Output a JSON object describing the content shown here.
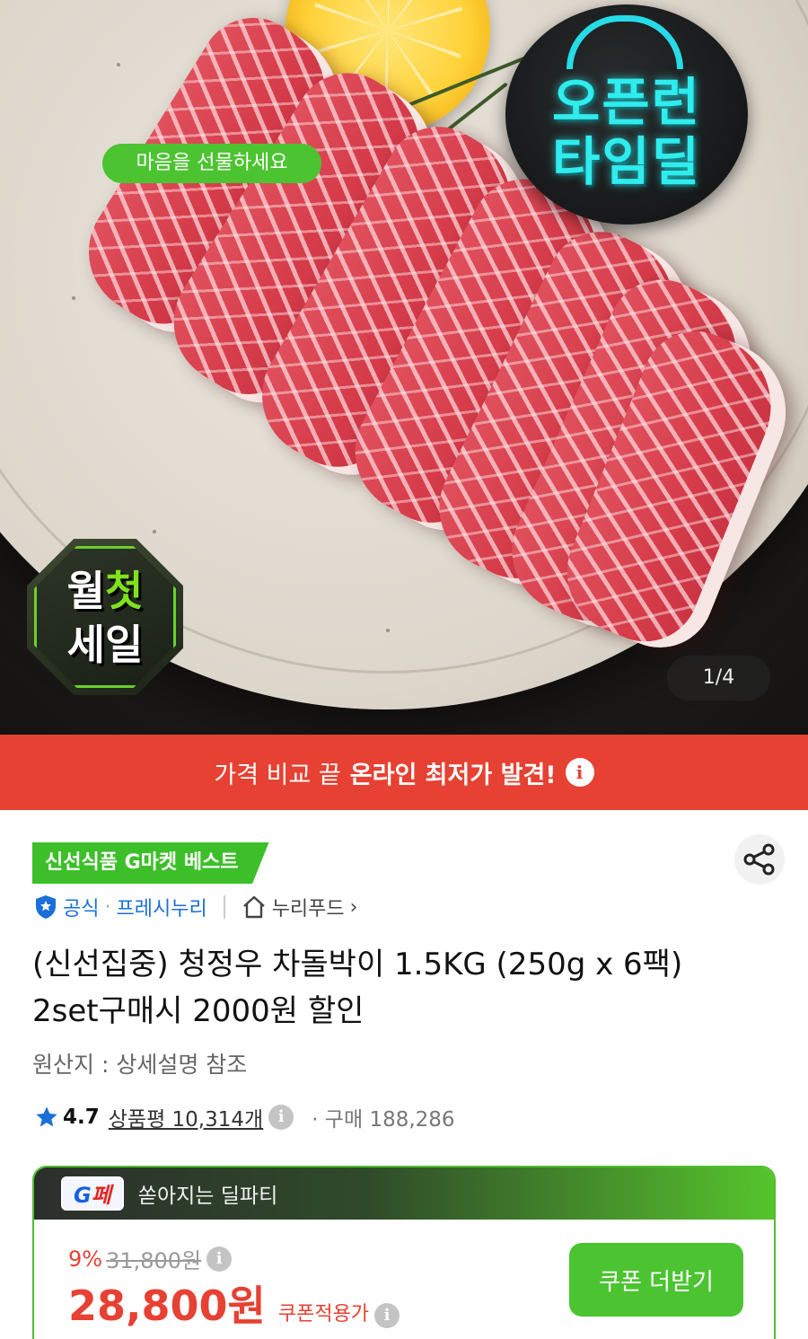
{
  "hero": {
    "badge_open_line1": "오픈런",
    "badge_open_line2": "타임딜",
    "badge_month_row1_a": "월",
    "badge_month_row1_b": "첫",
    "badge_month_row2": "세일",
    "counter": "1/4",
    "icons": {
      "clock": "alarm-clock-icon"
    }
  },
  "banner": {
    "prefix": "가격 비교 끝",
    "highlight": "온라인 최저가 발견!",
    "info_icon": "i"
  },
  "product": {
    "best_tag": "신선식품 G마켓 베스트",
    "seller_official": "공식",
    "seller_name": "프레시누리",
    "store_name": "누리푸드",
    "store_chevron": "›",
    "title": "(신선집중) 청정우 차돌박이 1.5KG (250g x 6팩) 2set구매시 2000원 할인",
    "origin": "원산지 : 상세설명 참조",
    "rating": "4.7",
    "review_text": "상품평 10,314개",
    "info_icon": "i",
    "buy_count": "· 구매 188,286"
  },
  "deal": {
    "logo_g": "G",
    "logo_rest": "페",
    "head_text": "쏟아지는 딜파티",
    "discount_pct": "9%",
    "original_price": "31,800원",
    "info_icon": "i",
    "price": "28,800원",
    "coupon_label": "쿠폰적용가",
    "coupon_button": "쿠폰 더받기",
    "pill_text": "마음을 선물하세요"
  },
  "colors": {
    "accent_red": "#e64132",
    "accent_green": "#4cc431",
    "seller_blue": "#1a6fd8"
  }
}
